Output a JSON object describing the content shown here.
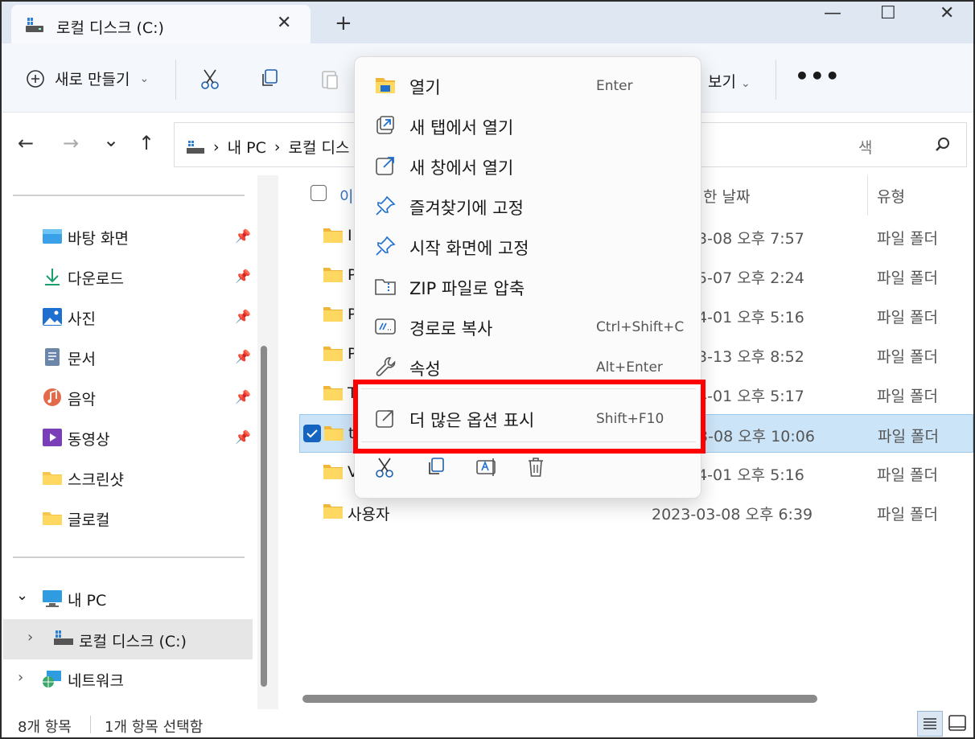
{
  "tab": {
    "title": "로컬 디스크 (C:)",
    "close_label": "✕",
    "newtab_label": "+"
  },
  "window_controls": {
    "minimize": "—",
    "maximize": "☐",
    "close": "✕"
  },
  "toolbar": {
    "new_label": "새로 만들기",
    "view_label": "보기",
    "more_label": "•••"
  },
  "nav": {
    "back": "←",
    "forward": "→",
    "recent": "⌄",
    "up": "↑",
    "breadcrumb": [
      "내 PC",
      "로컬 디스"
    ],
    "search_placeholder": "색"
  },
  "sidebar": {
    "quick_access": [
      {
        "label": "바탕 화면",
        "icon": "desktop-icon",
        "pinned": true
      },
      {
        "label": "다운로드",
        "icon": "download-icon",
        "pinned": true
      },
      {
        "label": "사진",
        "icon": "pictures-icon",
        "pinned": true
      },
      {
        "label": "문서",
        "icon": "documents-icon",
        "pinned": true
      },
      {
        "label": "음악",
        "icon": "music-icon",
        "pinned": true
      },
      {
        "label": "동영상",
        "icon": "videos-icon",
        "pinned": true
      },
      {
        "label": "스크린샷",
        "icon": "folder-icon",
        "pinned": false
      },
      {
        "label": "글로컬",
        "icon": "folder-icon",
        "pinned": false
      }
    ],
    "this_pc": "내 PC",
    "local_disk": "로컬 디스크 (C:)",
    "network": "네트워크"
  },
  "columns": {
    "name": "이",
    "date": "한 날짜",
    "type": "유형"
  },
  "files": [
    {
      "name": "I",
      "date": "3-03-08 오후 7:57",
      "type": "파일 폴더",
      "selected": false
    },
    {
      "name": "P",
      "date": "2-05-07 오후 2:24",
      "type": "파일 폴더",
      "selected": false
    },
    {
      "name": "P",
      "date": "3-04-01 오후 5:16",
      "type": "파일 폴더",
      "selected": false
    },
    {
      "name": "P",
      "date": "3-03-13 오후 8:52",
      "type": "파일 폴더",
      "selected": false
    },
    {
      "name": "T",
      "date": "3-04-01 오후 5:17",
      "type": "파일 폴더",
      "selected": false
    },
    {
      "name": "t",
      "date": "3-03-08 오후 10:06",
      "type": "파일 폴더",
      "selected": true
    },
    {
      "name": "V",
      "date": "3-04-01 오후 5:16",
      "type": "파일 폴더",
      "selected": false
    },
    {
      "name": "사용자",
      "date": "2023-03-08 오후 6:39",
      "type": "파일 폴더",
      "selected": false
    }
  ],
  "context_menu": {
    "items": [
      {
        "label": "열기",
        "shortcut": "Enter",
        "icon": "open-folder-icon"
      },
      {
        "label": "새 탭에서 열기",
        "shortcut": "",
        "icon": "new-tab-icon"
      },
      {
        "label": "새 창에서 열기",
        "shortcut": "",
        "icon": "new-window-icon"
      },
      {
        "label": "즐겨찾기에 고정",
        "shortcut": "",
        "icon": "pin-icon"
      },
      {
        "label": "시작 화면에 고정",
        "shortcut": "",
        "icon": "pin-icon"
      },
      {
        "label": "ZIP 파일로 압축",
        "shortcut": "",
        "icon": "zip-icon"
      },
      {
        "label": "경로로 복사",
        "shortcut": "Ctrl+Shift+C",
        "icon": "copy-path-icon"
      },
      {
        "label": "속성",
        "shortcut": "Alt+Enter",
        "icon": "wrench-icon"
      }
    ],
    "more_options": {
      "label": "더 많은 옵션 표시",
      "shortcut": "Shift+F10"
    }
  },
  "status": {
    "item_count": "8개 항목",
    "selected_count": "1개 항목 선택함"
  },
  "colors": {
    "highlight_border": "#ff0000",
    "accent": "#1565c0",
    "selection": "#cce4f7"
  }
}
